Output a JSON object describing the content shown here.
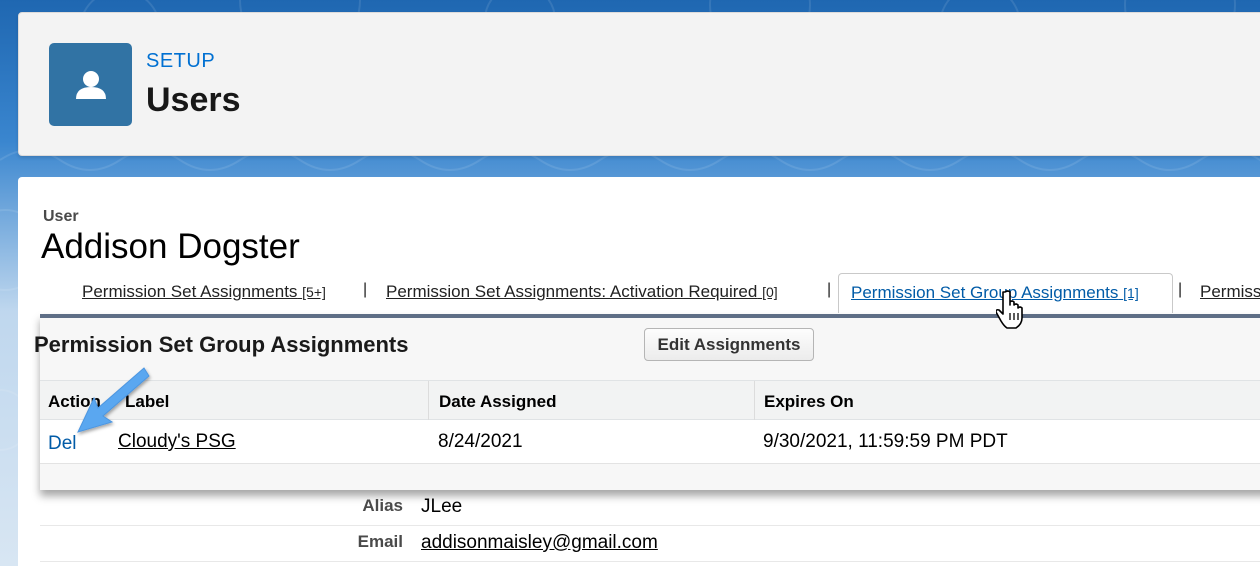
{
  "header": {
    "breadcrumb": "SETUP",
    "title": "Users",
    "icon": "user-icon",
    "icon_color": "#3173a4"
  },
  "user": {
    "label": "User",
    "name": "Addison Dogster"
  },
  "related_links": [
    {
      "label": "Permission Set Assignments",
      "count": "[5+]"
    },
    {
      "label": "Permission Set Assignments: Activation Required",
      "count": "[0]"
    },
    {
      "label": "Permission Set Group Assignments",
      "count": "[1]",
      "active": true
    },
    {
      "label": "Permiss",
      "count": ""
    }
  ],
  "section": {
    "title": "Permission Set Group Assignments",
    "edit_button": "Edit Assignments",
    "columns": [
      "Action",
      "Label",
      "Date Assigned",
      "Expires On"
    ],
    "rows": [
      {
        "action": "Del",
        "label": "Cloudy's PSG",
        "date_assigned": "8/24/2021",
        "expires_on": "9/30/2021, 11:59:59 PM PDT"
      }
    ]
  },
  "details": [
    {
      "label": "Alias",
      "value": "JLee"
    },
    {
      "label": "Email",
      "value": "addisonmaisley@gmail.com"
    }
  ],
  "colors": {
    "link": "#015ba7",
    "accent": "#0070d2",
    "annotation_arrow": "#5aa7f0"
  }
}
